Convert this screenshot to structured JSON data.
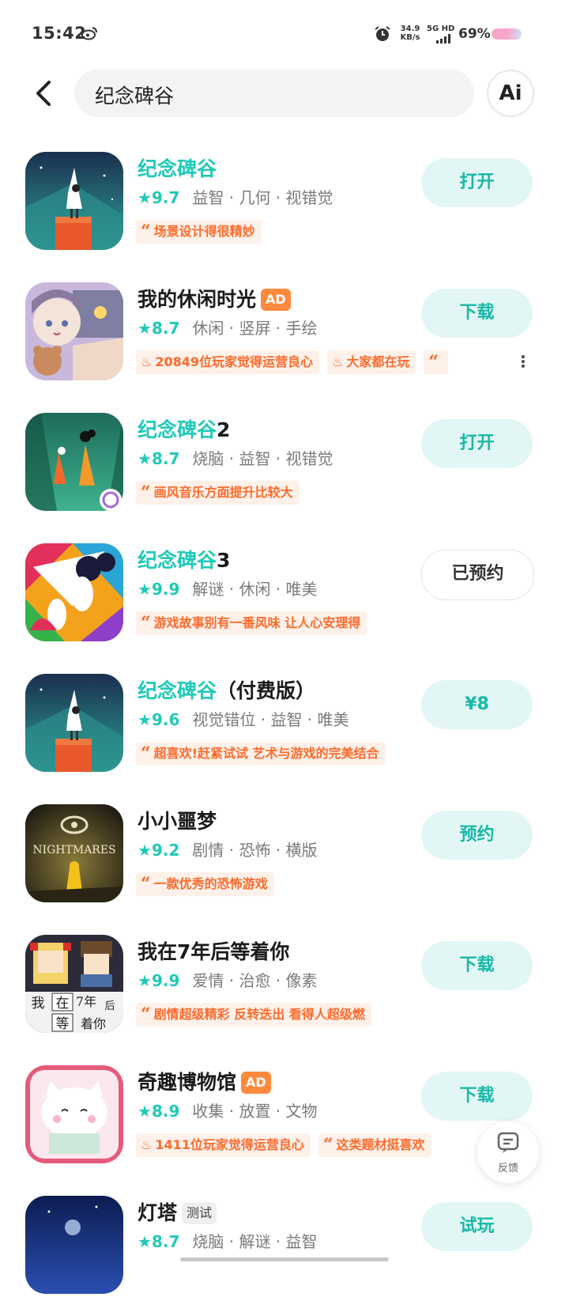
{
  "status": {
    "time": "15:42",
    "speed_top": "34.9",
    "speed_bottom": "KB/s",
    "network": "5G HD",
    "battery": "69%"
  },
  "search": {
    "query": "纪念碑谷",
    "ai_label": "Ai"
  },
  "accent": "#1fc9b7",
  "apps": [
    {
      "title_hl": "纪念碑谷",
      "title_rest": "",
      "badge": "",
      "rating": "9.7",
      "genres": "益智 · 几何 · 视错觉",
      "tags": [
        {
          "kind": "quote",
          "text": "场景设计得很精妙"
        }
      ],
      "button": "打开",
      "icon": "monument-valley-icon"
    },
    {
      "title_hl": "",
      "title_rest": "我的休闲时光",
      "badge": "AD",
      "rating": "8.7",
      "genres": "休闲 · 竖屏 · 手绘",
      "tags": [
        {
          "kind": "fire",
          "text": "20849位玩家觉得运营良心"
        },
        {
          "kind": "fire",
          "text": "大家都在玩"
        },
        {
          "kind": "quote",
          "text": ""
        }
      ],
      "button": "下载",
      "icon": "leisure-time-icon"
    },
    {
      "title_hl": "纪念碑谷",
      "title_rest": "2",
      "badge": "",
      "rating": "8.7",
      "genres": "烧脑 · 益智 · 视错觉",
      "tags": [
        {
          "kind": "quote",
          "text": "画风音乐方面提升比较大"
        }
      ],
      "button": "打开",
      "icon": "monument-valley-2-icon"
    },
    {
      "title_hl": "纪念碑谷",
      "title_rest": "3",
      "badge": "",
      "rating": "9.9",
      "genres": "解谜 · 休闲 · 唯美",
      "tags": [
        {
          "kind": "quote",
          "text": "游戏故事别有一番风味 让人心安理得"
        }
      ],
      "button": "已预约",
      "icon": "monument-valley-3-icon"
    },
    {
      "title_hl": "纪念碑谷",
      "title_rest": "（付费版）",
      "badge": "",
      "rating": "9.6",
      "genres": "视觉错位 · 益智 · 唯美",
      "tags": [
        {
          "kind": "quote",
          "text": "超喜欢!赶紧试试 艺术与游戏的完美结合"
        }
      ],
      "button": "¥8",
      "icon": "monument-valley-paid-icon"
    },
    {
      "title_hl": "",
      "title_rest": "小小噩梦",
      "badge": "",
      "rating": "9.2",
      "genres": "剧情 · 恐怖 · 横版",
      "tags": [
        {
          "kind": "quote",
          "text": "一款优秀的恐怖游戏"
        }
      ],
      "button": "预约",
      "icon": "little-nightmares-icon",
      "icon_text": "NIGHTMARES"
    },
    {
      "title_hl": "",
      "title_rest": "我在7年后等着你",
      "badge": "",
      "rating": "9.9",
      "genres": "爱情 · 治愈 · 像素",
      "tags": [
        {
          "kind": "quote",
          "text": "剧情超级精彩 反转迭出 看得人超级燃"
        }
      ],
      "button": "下载",
      "icon": "seven-years-icon",
      "icon_words": [
        "我",
        "在",
        "7年",
        "后",
        "等",
        "着你"
      ]
    },
    {
      "title_hl": "",
      "title_rest": "奇趣博物馆",
      "badge": "AD",
      "rating": "8.9",
      "genres": "收集 · 放置 · 文物",
      "tags": [
        {
          "kind": "fire",
          "text": "1411位玩家觉得运营良心"
        },
        {
          "kind": "quote",
          "text": "这类题材挺喜欢"
        }
      ],
      "button": "下载",
      "icon": "museum-cat-icon"
    },
    {
      "title_hl": "",
      "title_rest": "灯塔",
      "badge": "测试",
      "rating": "8.7",
      "genres": "烧脑 · 解谜 · 益智",
      "tags": [],
      "button": "试玩",
      "icon": "lighthouse-icon"
    }
  ],
  "feedback": {
    "label": "反馈"
  }
}
